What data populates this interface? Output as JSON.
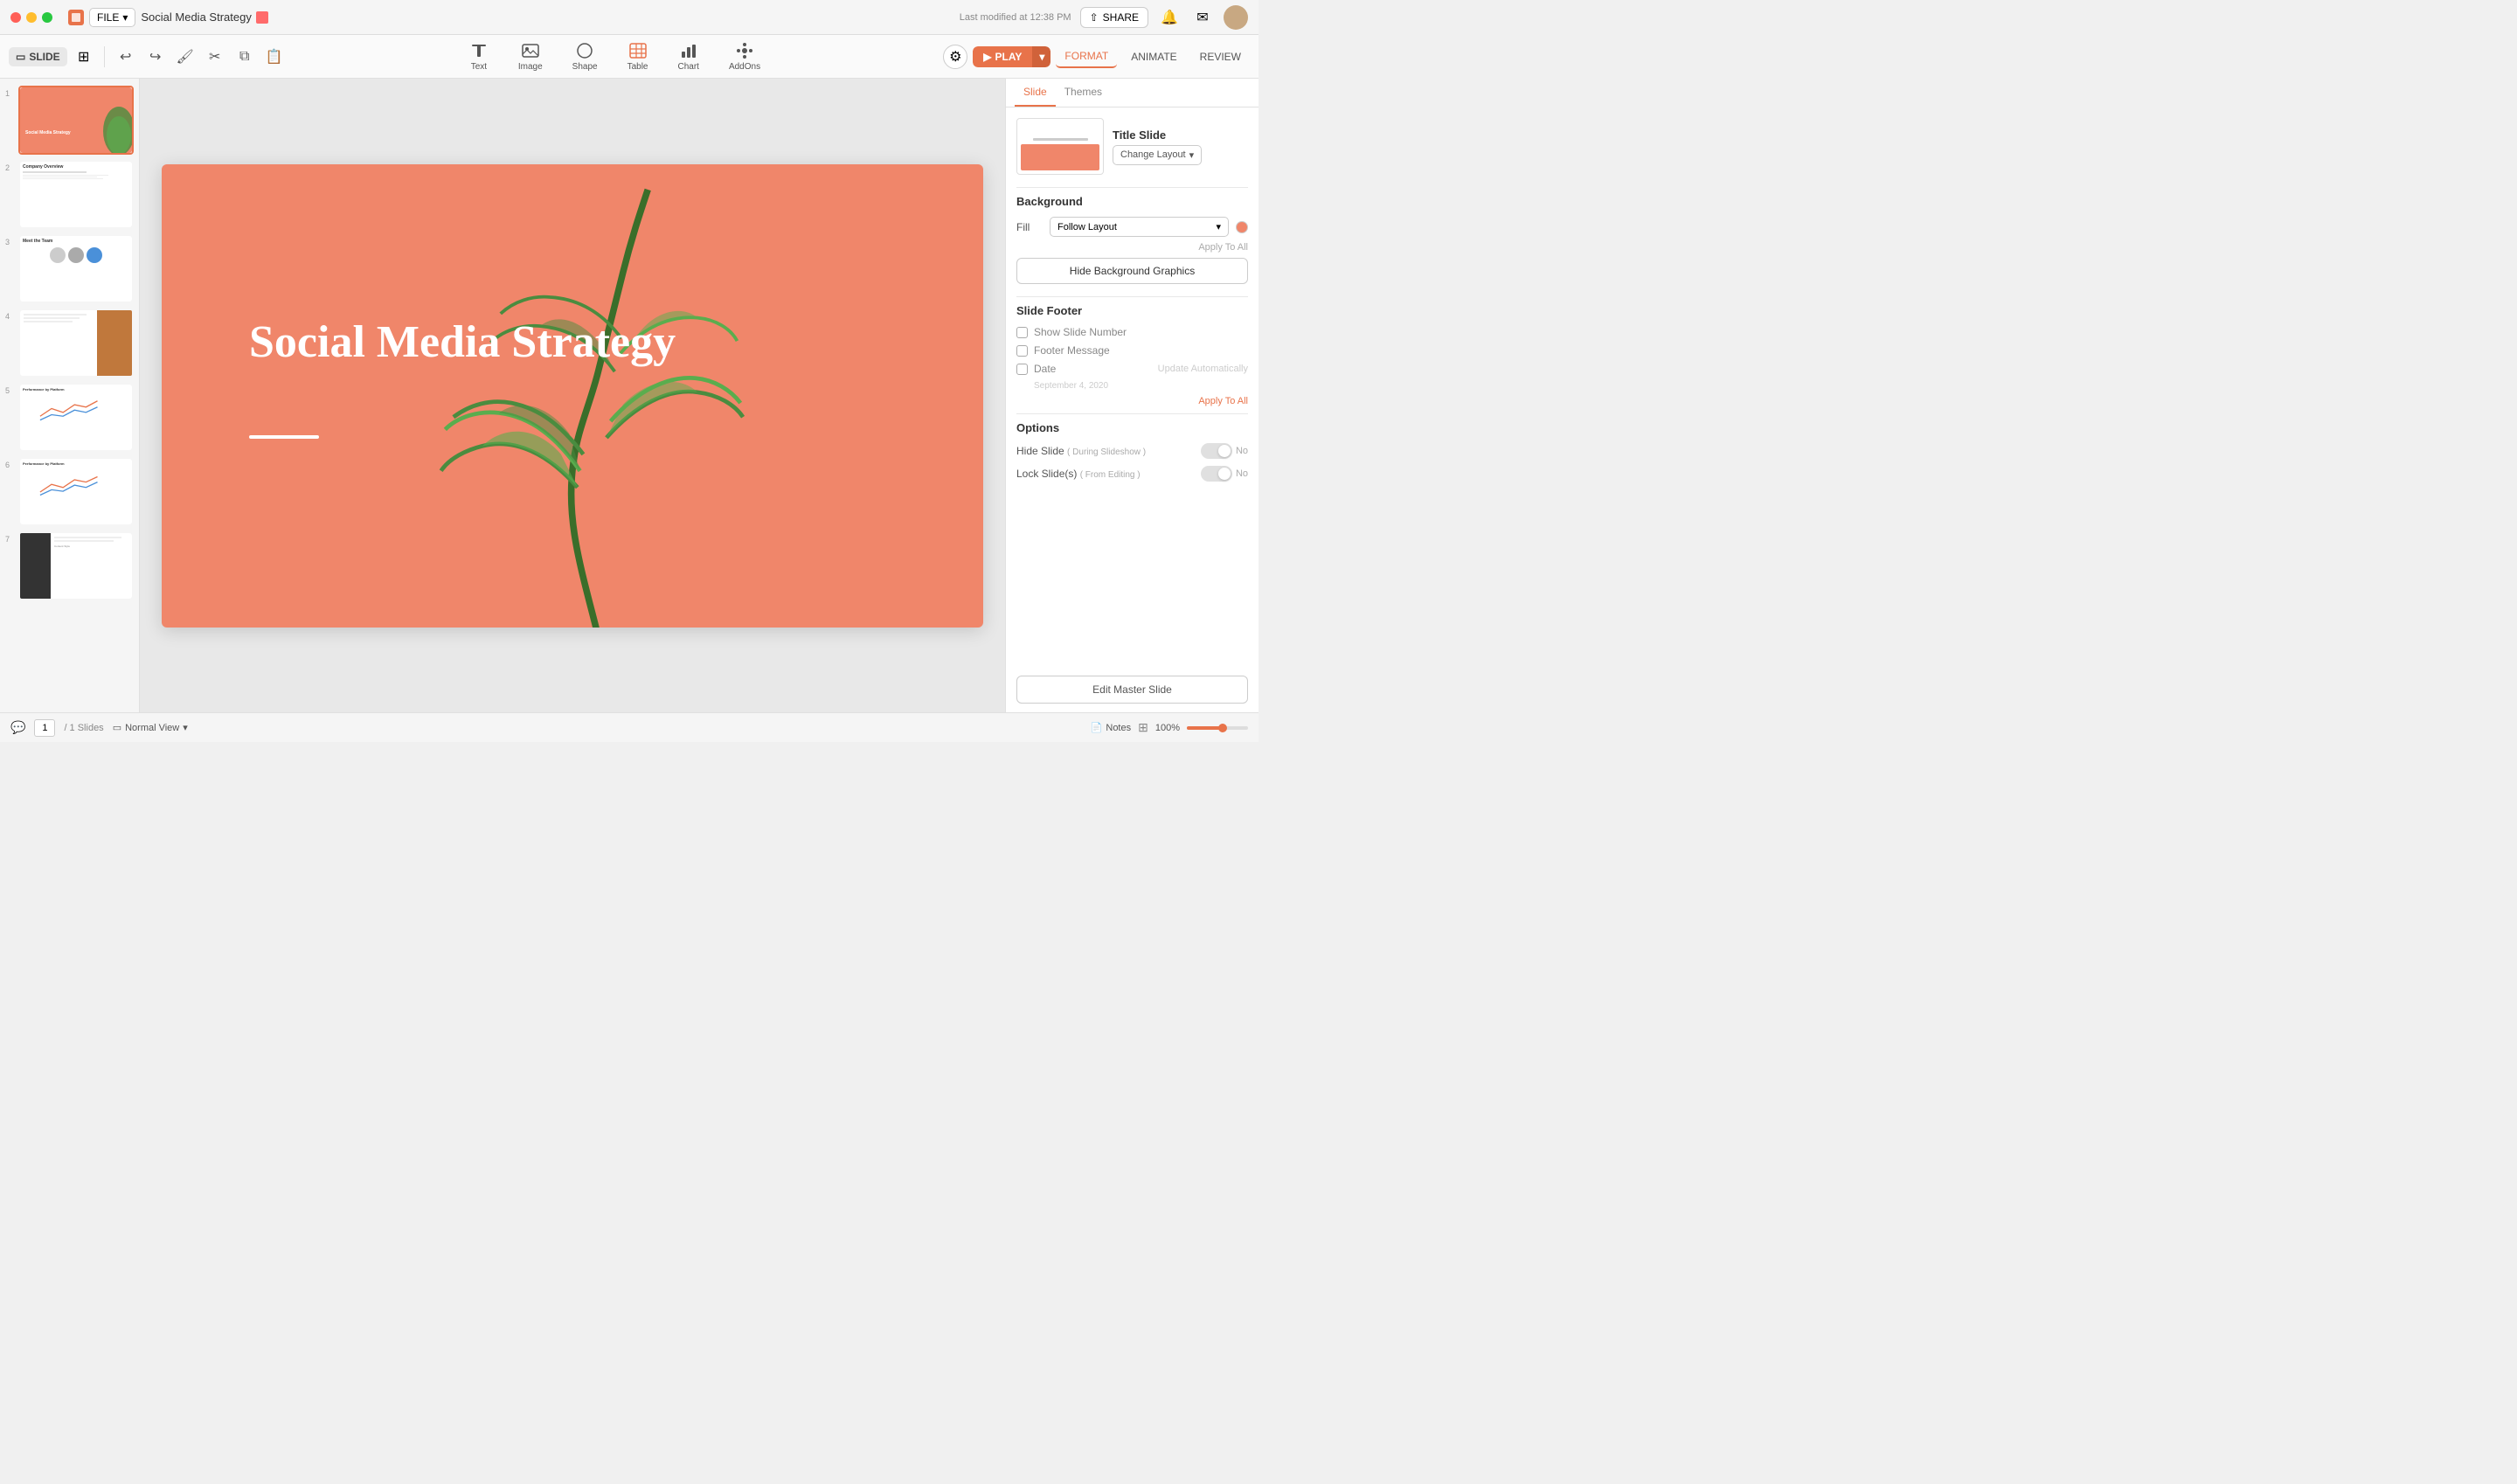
{
  "window": {
    "traffic_lights": [
      "red",
      "yellow",
      "green"
    ],
    "app_icon": "presentation-icon"
  },
  "titlebar": {
    "file_label": "FILE",
    "doc_title": "Social Media Strategy",
    "last_modified": "Last modified at 12:38 PM",
    "share_label": "SHARE"
  },
  "toolbar": {
    "slide_label": "SLIDE",
    "undo_label": "undo",
    "redo_label": "redo",
    "tools": [
      {
        "id": "text",
        "label": "Text",
        "icon": "text-icon"
      },
      {
        "id": "image",
        "label": "Image",
        "icon": "image-icon"
      },
      {
        "id": "shape",
        "label": "Shape",
        "icon": "shape-icon"
      },
      {
        "id": "table",
        "label": "Table",
        "icon": "table-icon"
      },
      {
        "id": "chart",
        "label": "Chart",
        "icon": "chart-icon"
      },
      {
        "id": "addons",
        "label": "AddOns",
        "icon": "addons-icon"
      }
    ],
    "play_label": "PLAY",
    "tabs": [
      {
        "id": "format",
        "label": "FORMAT",
        "active": true
      },
      {
        "id": "animate",
        "label": "ANIMATE"
      },
      {
        "id": "review",
        "label": "REVIEW"
      }
    ]
  },
  "slides": [
    {
      "num": 1,
      "selected": true
    },
    {
      "num": 2,
      "selected": false
    },
    {
      "num": 3,
      "selected": false
    },
    {
      "num": 4,
      "selected": false
    },
    {
      "num": 5,
      "selected": false
    },
    {
      "num": 6,
      "selected": false
    },
    {
      "num": 7,
      "selected": false
    }
  ],
  "slide": {
    "title": "Social Media Strategy",
    "background_color": "#f0866a"
  },
  "right_panel": {
    "tabs": [
      {
        "id": "slide",
        "label": "Slide",
        "active": true
      },
      {
        "id": "themes",
        "label": "Themes",
        "active": false
      }
    ],
    "layout": {
      "name": "Title Slide",
      "change_label": "Change Layout"
    },
    "background": {
      "section_title": "Background",
      "fill_label": "Fill",
      "fill_option": "Follow Layout",
      "apply_all": "Apply To All",
      "hide_bg_label": "Hide Background Graphics"
    },
    "footer": {
      "section_title": "Slide Footer",
      "show_slide_number": "Show Slide Number",
      "footer_message": "Footer Message",
      "date_label": "Date",
      "update_auto": "Update Automatically",
      "date_value": "September 4, 2020",
      "apply_all": "Apply To All"
    },
    "options": {
      "section_title": "Options",
      "hide_slide_label": "Hide Slide",
      "hide_slide_sub": "( During Slideshow )",
      "hide_slide_value": "No",
      "lock_slide_label": "Lock Slide(s)",
      "lock_slide_sub": "( From Editing )",
      "lock_slide_value": "No"
    },
    "edit_master": "Edit Master Slide"
  },
  "bottom_bar": {
    "page_current": "1",
    "page_total": "/ 1 Slides",
    "view_label": "Normal View",
    "notes_label": "Notes",
    "zoom_level": "100%"
  }
}
